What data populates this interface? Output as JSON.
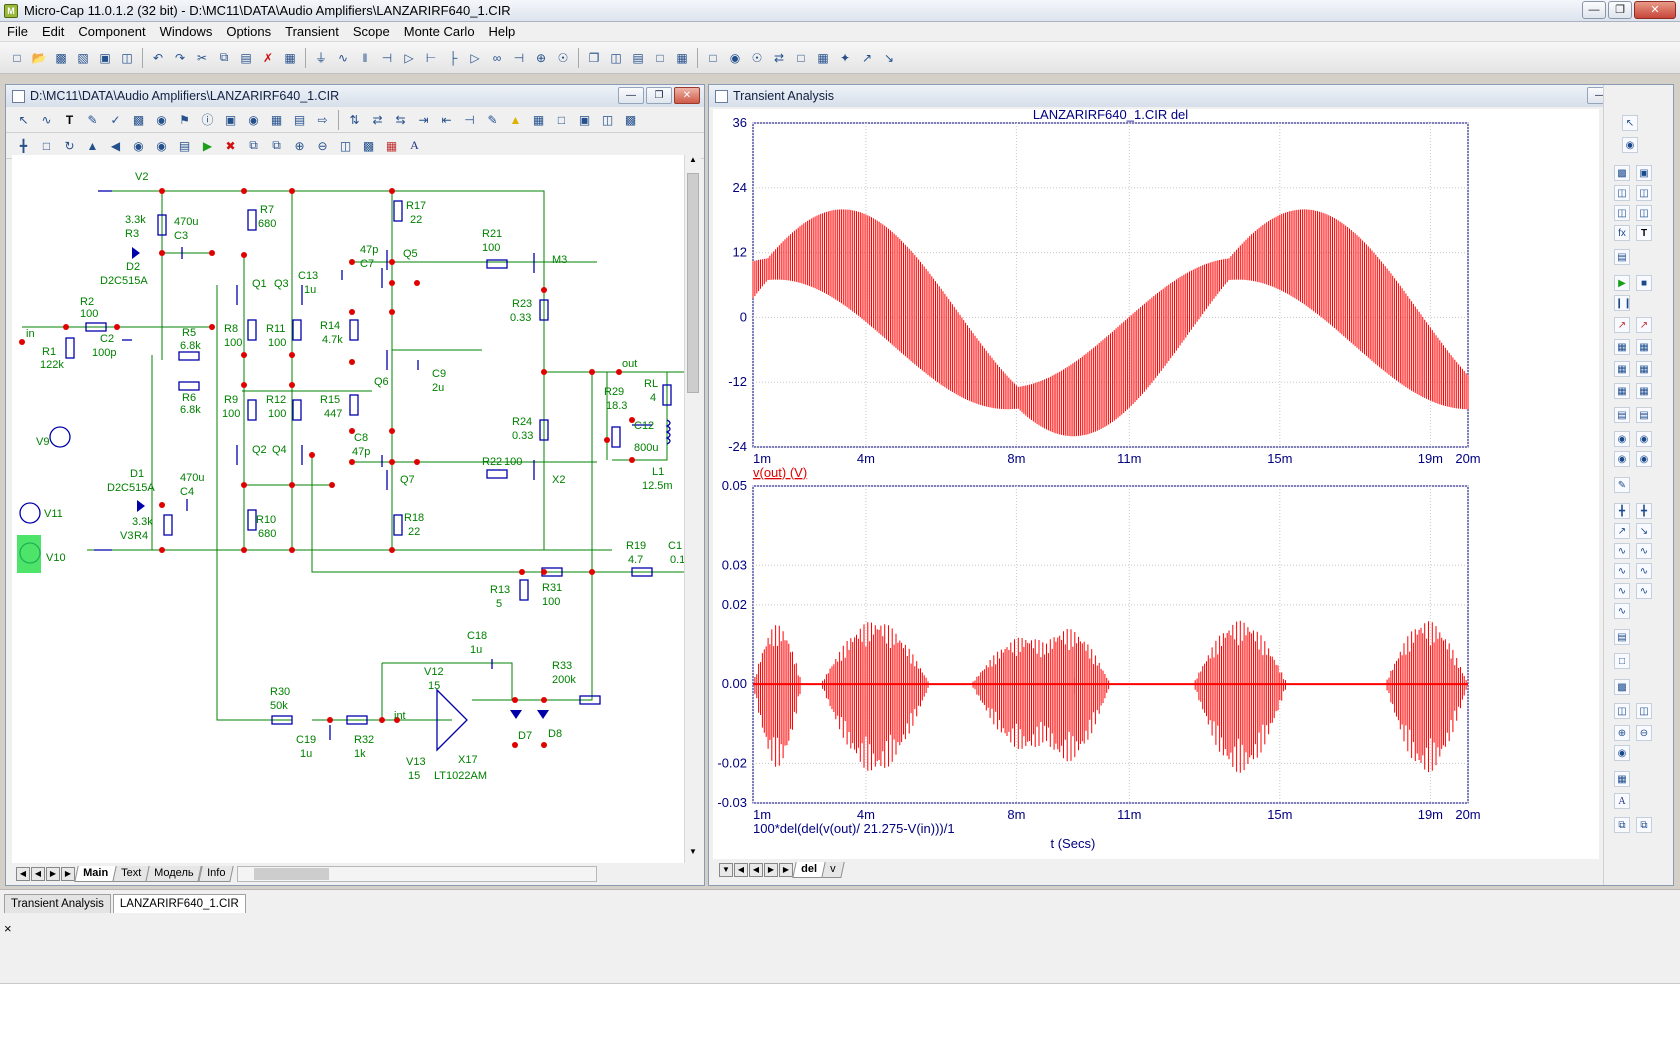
{
  "app": {
    "title": "Micro-Cap 11.0.1.2 (32 bit) - D:\\MC11\\DATA\\Audio Amplifiers\\LANZARIRF640_1.CIR"
  },
  "menu": [
    "File",
    "Edit",
    "Component",
    "Windows",
    "Options",
    "Transient",
    "Scope",
    "Monte Carlo",
    "Help"
  ],
  "schematic_window": {
    "title": "D:\\MC11\\DATA\\Audio Amplifiers\\LANZARIRF640_1.CIR",
    "tabs": [
      "Main",
      "Text",
      "Модель",
      "Info"
    ],
    "active_tab": "Main",
    "labels": {
      "V2": "V2",
      "R3v": "3.3k",
      "R3": "R3",
      "C3v": "470u",
      "C3": "C3",
      "D2": "D2",
      "D2m": "D2C515A",
      "R7": "R7",
      "R7v": "680",
      "R17": "R17",
      "R17v": "22",
      "R21": "R21",
      "R21v": "100",
      "M3": "M3",
      "C7": "C7",
      "C7v": "47p",
      "Q5": "Q5",
      "Q1": "Q1",
      "Q3": "Q3",
      "C13": "C13",
      "C13v": "1u",
      "R2": "R2",
      "R2v": "100",
      "in": "in",
      "R1": "R1",
      "R1v": "122k",
      "C2": "C2",
      "C2v": "100p",
      "R5": "R5",
      "R5v": "6.8k",
      "R8": "R8",
      "R8v": "100",
      "R11": "R11",
      "R11v": "100",
      "R14": "R14",
      "R14v": "4.7k",
      "R23": "R23",
      "R23v": "0.33",
      "Q6": "Q6",
      "C9": "C9",
      "C9v": "2u",
      "out": "out",
      "R29": "R29",
      "R29v": "18.3",
      "RL": "RL",
      "RLv": "4",
      "R6": "R6",
      "R6v": "6.8k",
      "R9": "R9",
      "R9v": "100",
      "R12": "R12",
      "R12v": "100",
      "R15": "R15",
      "R15v": "447",
      "V9": "V9",
      "R24": "R24",
      "R24v": "0.33",
      "C12": "C12",
      "C12v": "800u",
      "C8": "C8",
      "C8v": "47p",
      "Q2": "Q2",
      "Q4": "Q4",
      "R22": "R22",
      "R22v": "100",
      "X2": "X2",
      "L1": "L1",
      "L1v": "12.5m",
      "D1": "D1",
      "D1m": "D2C515A",
      "C4v": "470u",
      "C4": "C4",
      "Q7": "Q7",
      "V11": "V11",
      "R4v": "3.3k",
      "R4": "R4",
      "V3": "V3",
      "R10": "R10",
      "R10v": "680",
      "R18": "R18",
      "R18v": "22",
      "V10": "V10",
      "R19": "R19",
      "R19v": "4.7",
      "C1": "C1",
      "C1v": "0.1",
      "R13": "R13",
      "R13v": "5",
      "R31": "R31",
      "R31v": "100",
      "C18": "C18",
      "C18v": "1u",
      "R33": "R33",
      "R33v": "200k",
      "V12": "V12",
      "V12v": "15",
      "R30": "R30",
      "R30v": "50k",
      "int": "int",
      "C19": "C19",
      "C19v": "1u",
      "R32": "R32",
      "R32v": "1k",
      "D7": "D7",
      "D8": "D8",
      "X17": "X17",
      "X17m": "LT1022AM",
      "V13": "V13",
      "V13v": "15"
    }
  },
  "analysis_window": {
    "title": "Transient Analysis",
    "tabs": [
      "del",
      "v"
    ],
    "active_tab": "del"
  },
  "chart_data": [
    {
      "type": "line",
      "title": "LANZARIRF640_1.CIR del",
      "ylabel": "v(out) (V)",
      "ylim": [
        -24,
        36
      ],
      "yticks": [
        "36",
        "24",
        "12",
        "0",
        "-12",
        "-24"
      ],
      "xlim": [
        0.001,
        0.02
      ],
      "xticks": [
        "1m",
        "4m",
        "8m",
        "11m",
        "15m",
        "19m",
        "20m"
      ],
      "color": "#ff0000",
      "series": [
        {
          "name": "v(out) (V)",
          "kind": "beating sinusoid envelope",
          "envelope_high": [
            16,
            20,
            16,
            2,
            -7,
            4,
            20,
            16,
            -3,
            8
          ],
          "envelope_low": [
            -4,
            12,
            8,
            -18,
            -22,
            -6,
            8,
            2,
            -20,
            -10
          ],
          "x": [
            0.001,
            0.0025,
            0.0045,
            0.0075,
            0.009,
            0.0105,
            0.0135,
            0.015,
            0.018,
            0.02
          ]
        }
      ]
    },
    {
      "type": "line",
      "ylim": [
        -0.03,
        0.05
      ],
      "yticks": [
        "0.05",
        "0.03",
        "0.02",
        "0.00",
        "-0.02",
        "-0.03"
      ],
      "xlim": [
        0.001,
        0.02
      ],
      "xticks": [
        "1m",
        "4m",
        "8m",
        "11m",
        "15m",
        "19m",
        "20m"
      ],
      "xlabel": "t (Secs)",
      "ylabel": "100*del(del(v(out)/ 21.275-V(in)))/1",
      "color": "#ff0000",
      "series": [
        {
          "name": "100*del(del(v(out)/ 21.275-V(in)))/1",
          "kind": "bursts",
          "bursts": [
            [
              0.001,
              0.0023,
              0.015
            ],
            [
              0.0028,
              0.0057,
              0.016
            ],
            [
              0.0068,
              0.0097,
              0.012
            ],
            [
              0.0082,
              0.0105,
              0.014
            ],
            [
              0.0113,
              0.0114,
              0.0
            ],
            [
              0.0127,
              0.0152,
              0.016
            ],
            [
              0.0165,
              0.0166,
              0.0
            ],
            [
              0.0178,
              0.02,
              0.016
            ]
          ]
        }
      ]
    }
  ],
  "window_tabs": [
    "Transient Analysis",
    "LANZARIRF640_1.CIR"
  ],
  "command_close": "×"
}
